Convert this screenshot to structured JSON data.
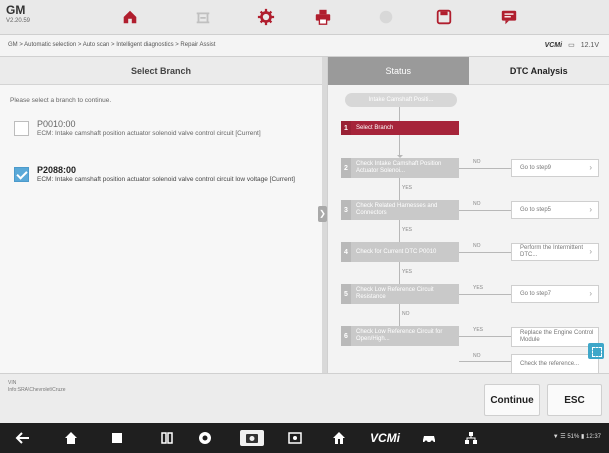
{
  "header": {
    "make": "GM",
    "version": "V2.20.59",
    "icons": [
      "home-icon",
      "vehicle-lift-icon",
      "gear-icon",
      "printer-icon",
      "help-icon",
      "save-icon",
      "chat-icon"
    ]
  },
  "breadcrumb": "GM > Automatic selection > Auto scan > Intelligent diagnostics > Repair Assist",
  "vci": {
    "label": "VCMi",
    "voltage": "12.1V"
  },
  "left_panel": {
    "title": "Select Branch",
    "instruction": "Please select a branch to continue.",
    "branches": [
      {
        "code": "P0010:00",
        "description": "ECM: Intake camshaft position actuator solenoid valve control circuit [Current]",
        "checked": false
      },
      {
        "code": "P2088:00",
        "description": "ECM: Intake camshaft position actuator solenoid valve control circuit low voltage [Current]",
        "checked": true
      }
    ]
  },
  "right_panel": {
    "tabs": [
      {
        "label": "Status",
        "active": true
      },
      {
        "label": "DTC Analysis",
        "active": false
      }
    ],
    "flow_title": "Intake Camshaft Positi...",
    "steps": [
      {
        "num": "1",
        "text": "Select Branch",
        "active": true
      },
      {
        "num": "2",
        "text": "Check Intake Camshaft Position Actuator Solenoi...",
        "branch_label": "NO",
        "result": "Go to step9"
      },
      {
        "num": "3",
        "text": "Check Related Harnesses and Connectors",
        "branch_label": "NO",
        "result": "Go to step5"
      },
      {
        "num": "4",
        "text": "Check for Current DTC P0010",
        "branch_label": "NO",
        "result": "Perform the Intermittent DTC..."
      },
      {
        "num": "5",
        "text": "Check Low Reference Circuit Resistance",
        "branch_label": "YES",
        "result": "Go to step7"
      },
      {
        "num": "6",
        "text": "Check Low Reference Circuit for Open/High...",
        "branch_label": "YES",
        "result": "Replace the Engine Control Module"
      }
    ],
    "connectors": [
      "YES",
      "YES",
      "YES",
      "NO"
    ],
    "partial_label": "NO",
    "partial_result": "Check the reference..."
  },
  "footer": {
    "vin_label": "VIN",
    "vin_value": "Info:SRA\\Chevrolet\\Cruze",
    "continue_label": "Continue",
    "esc_label": "ESC"
  },
  "navbar": {
    "icons": [
      "back-icon",
      "home-icon",
      "recent-apps-icon",
      "split-screen-icon",
      "browser-icon",
      "camera-icon",
      "screen-record-icon",
      "home-house-icon",
      "vcmi-icon",
      "car-icon",
      "network-icon"
    ],
    "vcmi_label": "VCMi",
    "status_text": "▼ ☰ 51% ▮ 12:37"
  }
}
